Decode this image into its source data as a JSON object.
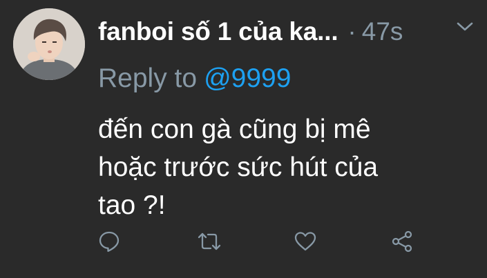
{
  "tweet": {
    "display_name": "fanboi số 1 của ka...",
    "separator": "·",
    "timestamp": "47s",
    "reply_prefix": "Reply to",
    "reply_handle": "@9999",
    "text_lines": [
      "đến con gà cũng bị mê",
      "hoặc trước sức hút của",
      "tao ?!"
    ]
  },
  "icons": {
    "menu": "chevron-down-icon",
    "reply": "comment-icon",
    "retweet": "retweet-icon",
    "like": "heart-icon",
    "share": "share-icon"
  },
  "colors": {
    "background": "#2a2a2a",
    "muted_text": "#8899a6",
    "link": "#1da1f2",
    "primary_text": "#ffffff"
  }
}
